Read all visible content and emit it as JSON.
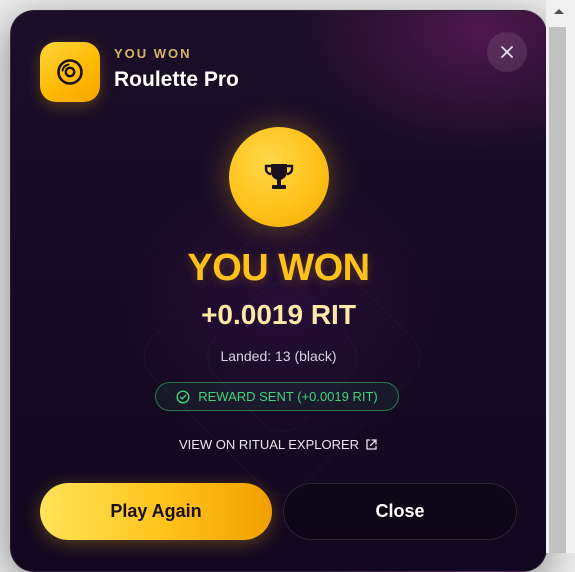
{
  "header": {
    "eyebrow": "YOU WON",
    "title": "Roulette Pro",
    "icon": "roulette-disc-icon"
  },
  "result": {
    "headline": "YOU WON",
    "amount": "+0.0019 RIT",
    "landed": "Landed: 13 (black)",
    "icon": "trophy-icon"
  },
  "reward": {
    "label": "REWARD SENT (+0.0019 RIT)",
    "icon": "check-circle-icon"
  },
  "explorer": {
    "label": "VIEW ON RITUAL EXPLORER",
    "icon": "external-link-icon"
  },
  "actions": {
    "play_again": "Play Again",
    "close": "Close"
  },
  "colors": {
    "accent_gold": "#ffc21a",
    "success_green": "#43d17a",
    "background": "#150a22"
  }
}
